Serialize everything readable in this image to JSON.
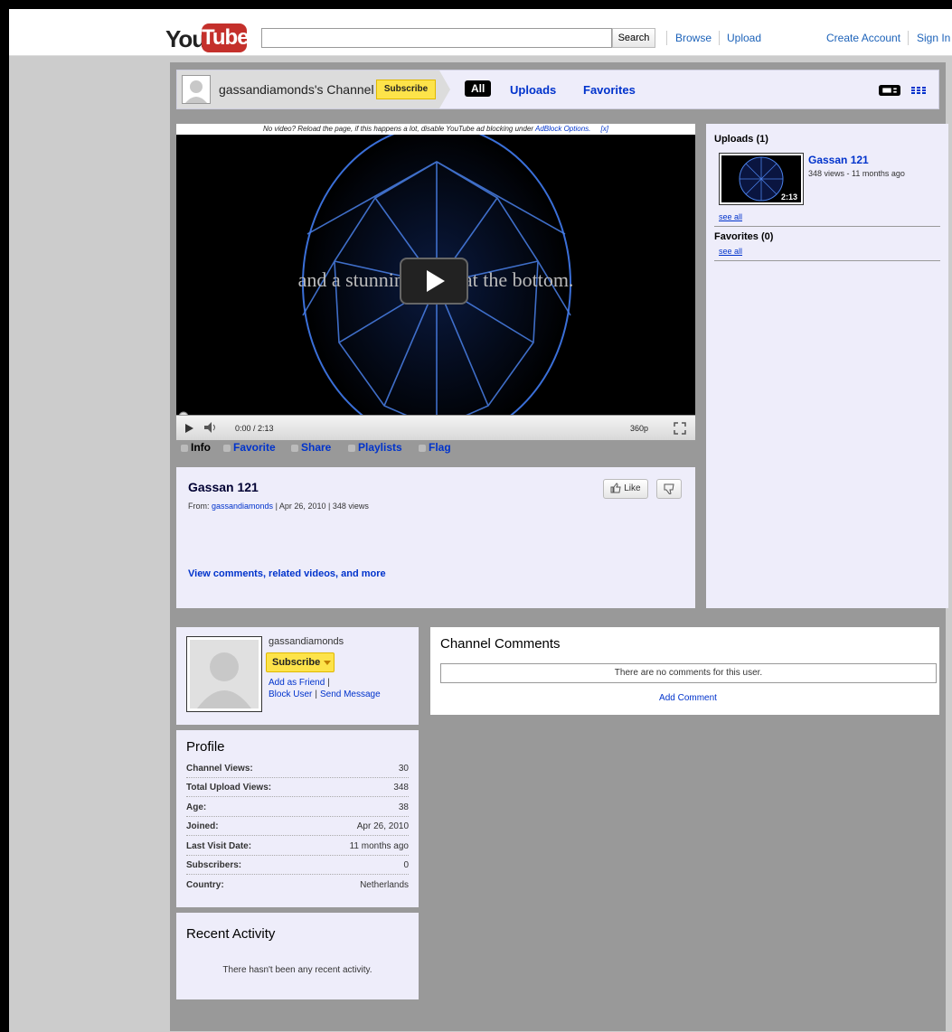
{
  "header": {
    "logo_you": "You",
    "logo_tube": "Tube",
    "search_button": "Search",
    "links": {
      "browse": "Browse",
      "upload": "Upload",
      "create_account": "Create Account",
      "sign_in": "Sign In"
    }
  },
  "channel_nav": {
    "channel_name": "gassandiamonds's Channel",
    "subscribe": "Subscribe",
    "tabs": {
      "all": "All",
      "uploads": "Uploads",
      "favorites": "Favorites"
    }
  },
  "player": {
    "ad_note": "No video? Reload the page, if this happens a lot, disable YouTube ad blocking under",
    "ad_note_link": "AdBlock Options.",
    "ad_note_close": "[x]",
    "overlay_text": "and a stunning heart at the bottom.",
    "time": "0:00 / 2:13",
    "quality": "360p"
  },
  "info_tabs": {
    "info": "Info",
    "favorite": "Favorite",
    "share": "Share",
    "playlists": "Playlists",
    "flag": "Flag"
  },
  "video_info": {
    "title": "Gassan 121",
    "from_label": "From:",
    "from_user": "gassandiamonds",
    "date": "| Apr 26, 2010",
    "views": "| 348 views",
    "like": "Like",
    "more_link": "View comments, related videos, and more"
  },
  "sidebar": {
    "uploads_heading": "Uploads (1)",
    "video_title": "Gassan 121",
    "video_meta": "348 views - 11 months ago",
    "duration": "2:13",
    "see_all_1": "see all",
    "favorites_heading": "Favorites (0)",
    "see_all_2": "see all"
  },
  "user": {
    "name": "gassandiamonds",
    "subscribe": "Subscribe",
    "add_friend": "Add as Friend",
    "block_user": "Block User",
    "send_message": "Send Message",
    "sep": "|"
  },
  "comments": {
    "heading": "Channel Comments",
    "empty": "There are no comments for this user.",
    "add": "Add Comment"
  },
  "profile": {
    "heading": "Profile",
    "rows": [
      {
        "k": "Channel Views:",
        "v": "30"
      },
      {
        "k": "Total Upload Views:",
        "v": "348"
      },
      {
        "k": "Age:",
        "v": "38"
      },
      {
        "k": "Joined:",
        "v": "Apr 26, 2010"
      },
      {
        "k": "Last Visit Date:",
        "v": "11 months ago"
      },
      {
        "k": "Subscribers:",
        "v": "0"
      },
      {
        "k": "Country:",
        "v": "Netherlands"
      }
    ]
  },
  "activity": {
    "heading": "Recent Activity",
    "empty": "There hasn't been any recent activity."
  },
  "colors": {
    "link": "#0033cc",
    "subscribe_yellow": "#fde34a",
    "panel_bg": "#eeedfa",
    "youtube_red": "#c4302b"
  }
}
